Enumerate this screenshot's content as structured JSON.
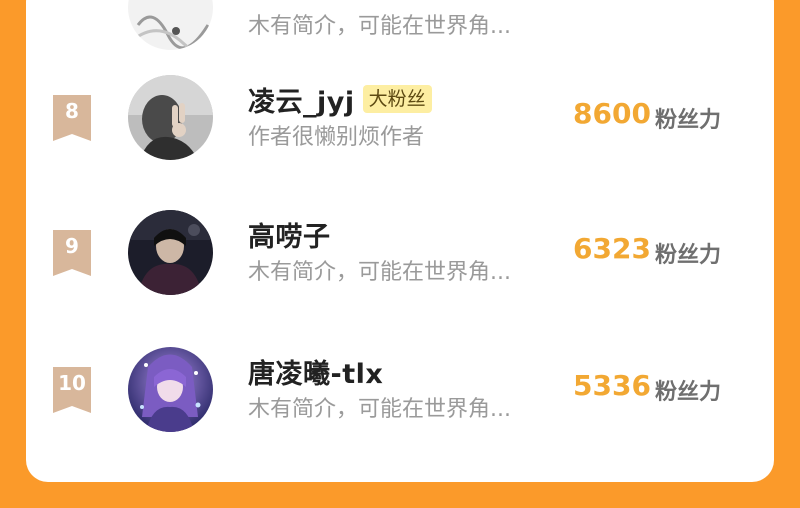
{
  "prev_item": {
    "bio": "木有简介，可能在世界角..."
  },
  "fans": [
    {
      "rank": "8",
      "name": "凌云_jyj",
      "badge": "大粉丝",
      "bio": "作者很懒别烦作者",
      "score": "8600",
      "unit": "粉丝力",
      "avatar_icon": "avatar-hand-gesture"
    },
    {
      "rank": "9",
      "name": "高唠子",
      "badge": "",
      "bio": "木有简介，可能在世界角...",
      "score": "6323",
      "unit": "粉丝力",
      "avatar_icon": "avatar-dark-portrait"
    },
    {
      "rank": "10",
      "name": "唐凌曦-tlx",
      "badge": "",
      "bio": "木有简介，可能在世界角...",
      "score": "5336",
      "unit": "粉丝力",
      "avatar_icon": "avatar-anime-girl"
    }
  ],
  "colors": {
    "background": "#fb9a2a",
    "card": "#ffffff",
    "score": "#f2a833",
    "rank_badge": "#d8b79b",
    "fan_badge_bg": "#fdeea2"
  }
}
